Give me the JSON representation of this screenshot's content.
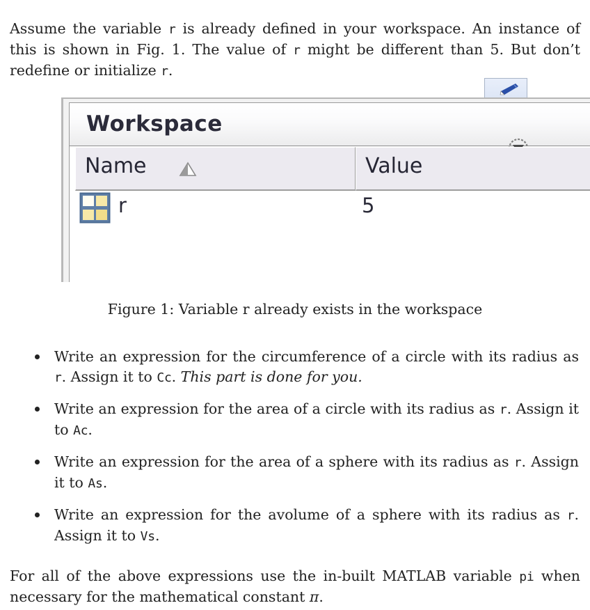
{
  "document": {
    "intro": {
      "segments": [
        {
          "text": "Assume the variable ",
          "style": "roman"
        },
        {
          "text": "r",
          "style": "tt"
        },
        {
          "text": " is already defined in your workspace. An instance of this is shown in Fig. 1. The value of ",
          "style": "roman"
        },
        {
          "text": "r",
          "style": "tt"
        },
        {
          "text": " might be different than 5. But don’t redefine or initialize ",
          "style": "roman"
        },
        {
          "text": "r",
          "style": "tt"
        },
        {
          "text": ".",
          "style": "roman"
        }
      ],
      "plain": "Assume the variable r is already defined in your workspace. An instance of this is shown in Fig. 1. The value of r might be different than 5. But don’t redefine or initialize r."
    },
    "figure": {
      "caption": "Figure 1: Variable r already exists in the workspace",
      "caption_label": "Figure 1:",
      "caption_text": "Variable r already exists in the workspace"
    },
    "tasks": [
      {
        "segments": [
          {
            "text": "Write an expression for the circumference of a circle with its radius as ",
            "style": "roman"
          },
          {
            "text": "r",
            "style": "tt"
          },
          {
            "text": ". Assign it to ",
            "style": "roman"
          },
          {
            "text": "Cc",
            "style": "tt"
          },
          {
            "text": ". ",
            "style": "roman"
          },
          {
            "text": "This part is done for you.",
            "style": "italic"
          }
        ],
        "variable": "Cc",
        "quantity": "circumference of a circle",
        "note": "This part is done for you."
      },
      {
        "segments": [
          {
            "text": "Write an expression for the area of a circle with its radius as ",
            "style": "roman"
          },
          {
            "text": "r",
            "style": "tt"
          },
          {
            "text": ". Assign it to ",
            "style": "roman"
          },
          {
            "text": "Ac",
            "style": "tt"
          },
          {
            "text": ".",
            "style": "roman"
          }
        ],
        "variable": "Ac",
        "quantity": "area of a circle",
        "note": ""
      },
      {
        "segments": [
          {
            "text": "Write an expression for the area of a sphere with its radius as ",
            "style": "roman"
          },
          {
            "text": "r",
            "style": "tt"
          },
          {
            "text": ". Assign it to ",
            "style": "roman"
          },
          {
            "text": "As",
            "style": "tt"
          },
          {
            "text": ".",
            "style": "roman"
          }
        ],
        "variable": "As",
        "quantity": "area of a sphere",
        "note": ""
      },
      {
        "segments": [
          {
            "text": "Write an expression for the avolume of a sphere with its radius as ",
            "style": "roman"
          },
          {
            "text": "r",
            "style": "tt"
          },
          {
            "text": ". Assign it to ",
            "style": "roman"
          },
          {
            "text": "Vs",
            "style": "tt"
          },
          {
            "text": ".",
            "style": "roman"
          }
        ],
        "variable": "Vs",
        "quantity": "avolume of a sphere",
        "note": ""
      }
    ],
    "closing": {
      "segments": [
        {
          "text": "For all of the above expressions use the in-built MATLAB variable ",
          "style": "roman"
        },
        {
          "text": "pi",
          "style": "tt"
        },
        {
          "text": " when necessary for the mathematical constant ",
          "style": "roman"
        },
        {
          "text": "π",
          "style": "math"
        },
        {
          "text": ".",
          "style": "roman"
        }
      ],
      "plain": "For all of the above expressions use the in-built MATLAB variable pi when necessary for the mathematical constant π."
    }
  },
  "workspace_panel": {
    "title": "Workspace",
    "menu_button_icon": "chevron-down-circle-icon",
    "editor_tab_icon": "pen-icon",
    "columns": [
      {
        "label": "Name",
        "sorted": "ascending",
        "sort_icon": "sort-ascending-icon"
      },
      {
        "label": "Value",
        "sorted": "none",
        "sort_icon": ""
      }
    ],
    "rows": [
      {
        "icon": "matrix-variable-icon",
        "name": "r",
        "value": "5"
      }
    ],
    "colors": {
      "title_text": "#2b2b3a",
      "header_bg": "#eceaf0",
      "panel_bg": "#ffffff",
      "frame": "#9a9a9a",
      "icon_frame": "#5f7fa6",
      "icon_fill": "#f5de8c",
      "tab_accent": "#2a4fa8"
    }
  }
}
